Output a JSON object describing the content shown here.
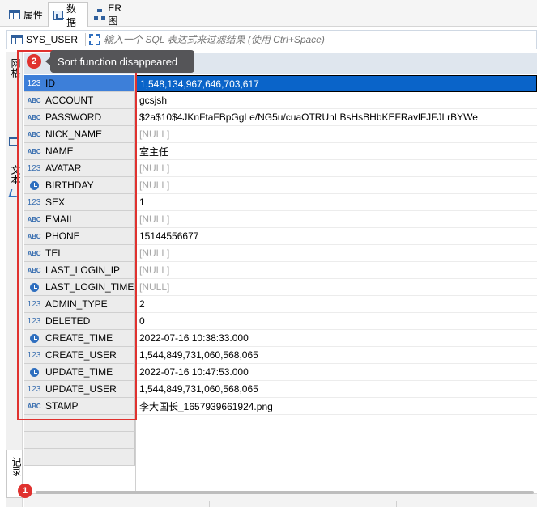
{
  "tabs": [
    {
      "label": "属性",
      "icon": "table-icon"
    },
    {
      "label": "数据",
      "icon": "data-grid-icon"
    },
    {
      "label": "ER 图",
      "icon": "er-diagram-icon"
    }
  ],
  "filter": {
    "entity": "SYS_USER",
    "placeholder": "输入一个 SQL 表达式来过滤结果 (使用 Ctrl+Space)"
  },
  "side_strip": {
    "grid_label": "网格",
    "text_label": "文本",
    "record_label": "记录"
  },
  "tooltip": {
    "text": "Sort function disappeared",
    "badge": "2"
  },
  "badge_bottom": "1",
  "rows": [
    {
      "type": "123",
      "name": "ID",
      "value": "1,548,134,967,646,703,617"
    },
    {
      "type": "ABC",
      "name": "ACCOUNT",
      "value": "gcsjsh"
    },
    {
      "type": "ABC",
      "name": "PASSWORD",
      "value": "$2a$10$4JKnFtaFBpGgLe/NG5u/cuaOTRUnLBsHsBHbKEFRavlFJFJLrBYWe"
    },
    {
      "type": "ABC",
      "name": "NICK_NAME",
      "value": "[NULL]"
    },
    {
      "type": "ABC",
      "name": "NAME",
      "value": "室主任"
    },
    {
      "type": "123",
      "name": "AVATAR",
      "value": "[NULL]"
    },
    {
      "type": "date",
      "name": "BIRTHDAY",
      "value": "[NULL]"
    },
    {
      "type": "123",
      "name": "SEX",
      "value": "1"
    },
    {
      "type": "ABC",
      "name": "EMAIL",
      "value": "[NULL]"
    },
    {
      "type": "ABC",
      "name": "PHONE",
      "value": "15144556677"
    },
    {
      "type": "ABC",
      "name": "TEL",
      "value": "[NULL]"
    },
    {
      "type": "ABC",
      "name": "LAST_LOGIN_IP",
      "value": "[NULL]"
    },
    {
      "type": "date",
      "name": "LAST_LOGIN_TIME",
      "value": "[NULL]"
    },
    {
      "type": "123",
      "name": "ADMIN_TYPE",
      "value": "2"
    },
    {
      "type": "123",
      "name": "DELETED",
      "value": "0"
    },
    {
      "type": "date",
      "name": "CREATE_TIME",
      "value": "2022-07-16 10:38:33.000"
    },
    {
      "type": "123",
      "name": "CREATE_USER",
      "value": "1,544,849,731,060,568,065"
    },
    {
      "type": "date",
      "name": "UPDATE_TIME",
      "value": "2022-07-16 10:47:53.000"
    },
    {
      "type": "123",
      "name": "UPDATE_USER",
      "value": "1,544,849,731,060,568,065"
    },
    {
      "type": "ABC",
      "name": "STAMP",
      "value": "李大国长_1657939661924.png"
    }
  ],
  "colors": {
    "selection": "#0a64c9",
    "annotation": "#e0322f",
    "tooltip_bg": "#555558"
  }
}
